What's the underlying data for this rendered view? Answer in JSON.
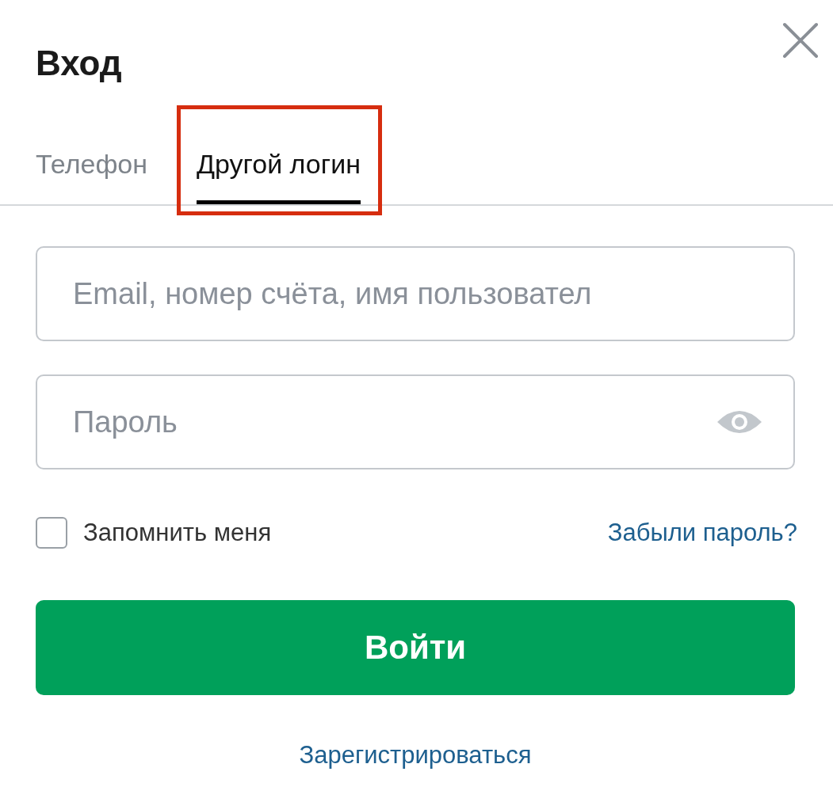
{
  "title": "Вход",
  "tabs": [
    {
      "label": "Телефон",
      "selected": false,
      "highlighted": false
    },
    {
      "label": "Другой логин",
      "selected": true,
      "highlighted": true
    }
  ],
  "fields": [
    {
      "placeholder": "Email, номер счёта, имя пользовател",
      "kind": "text"
    },
    {
      "placeholder": "Пароль",
      "kind": "password"
    }
  ],
  "remember": {
    "label": "Запомнить меня",
    "checked": false
  },
  "forgot_link": "Забыли пароль?",
  "submit_button": "Войти",
  "register_link": "Зарегистрироваться"
}
